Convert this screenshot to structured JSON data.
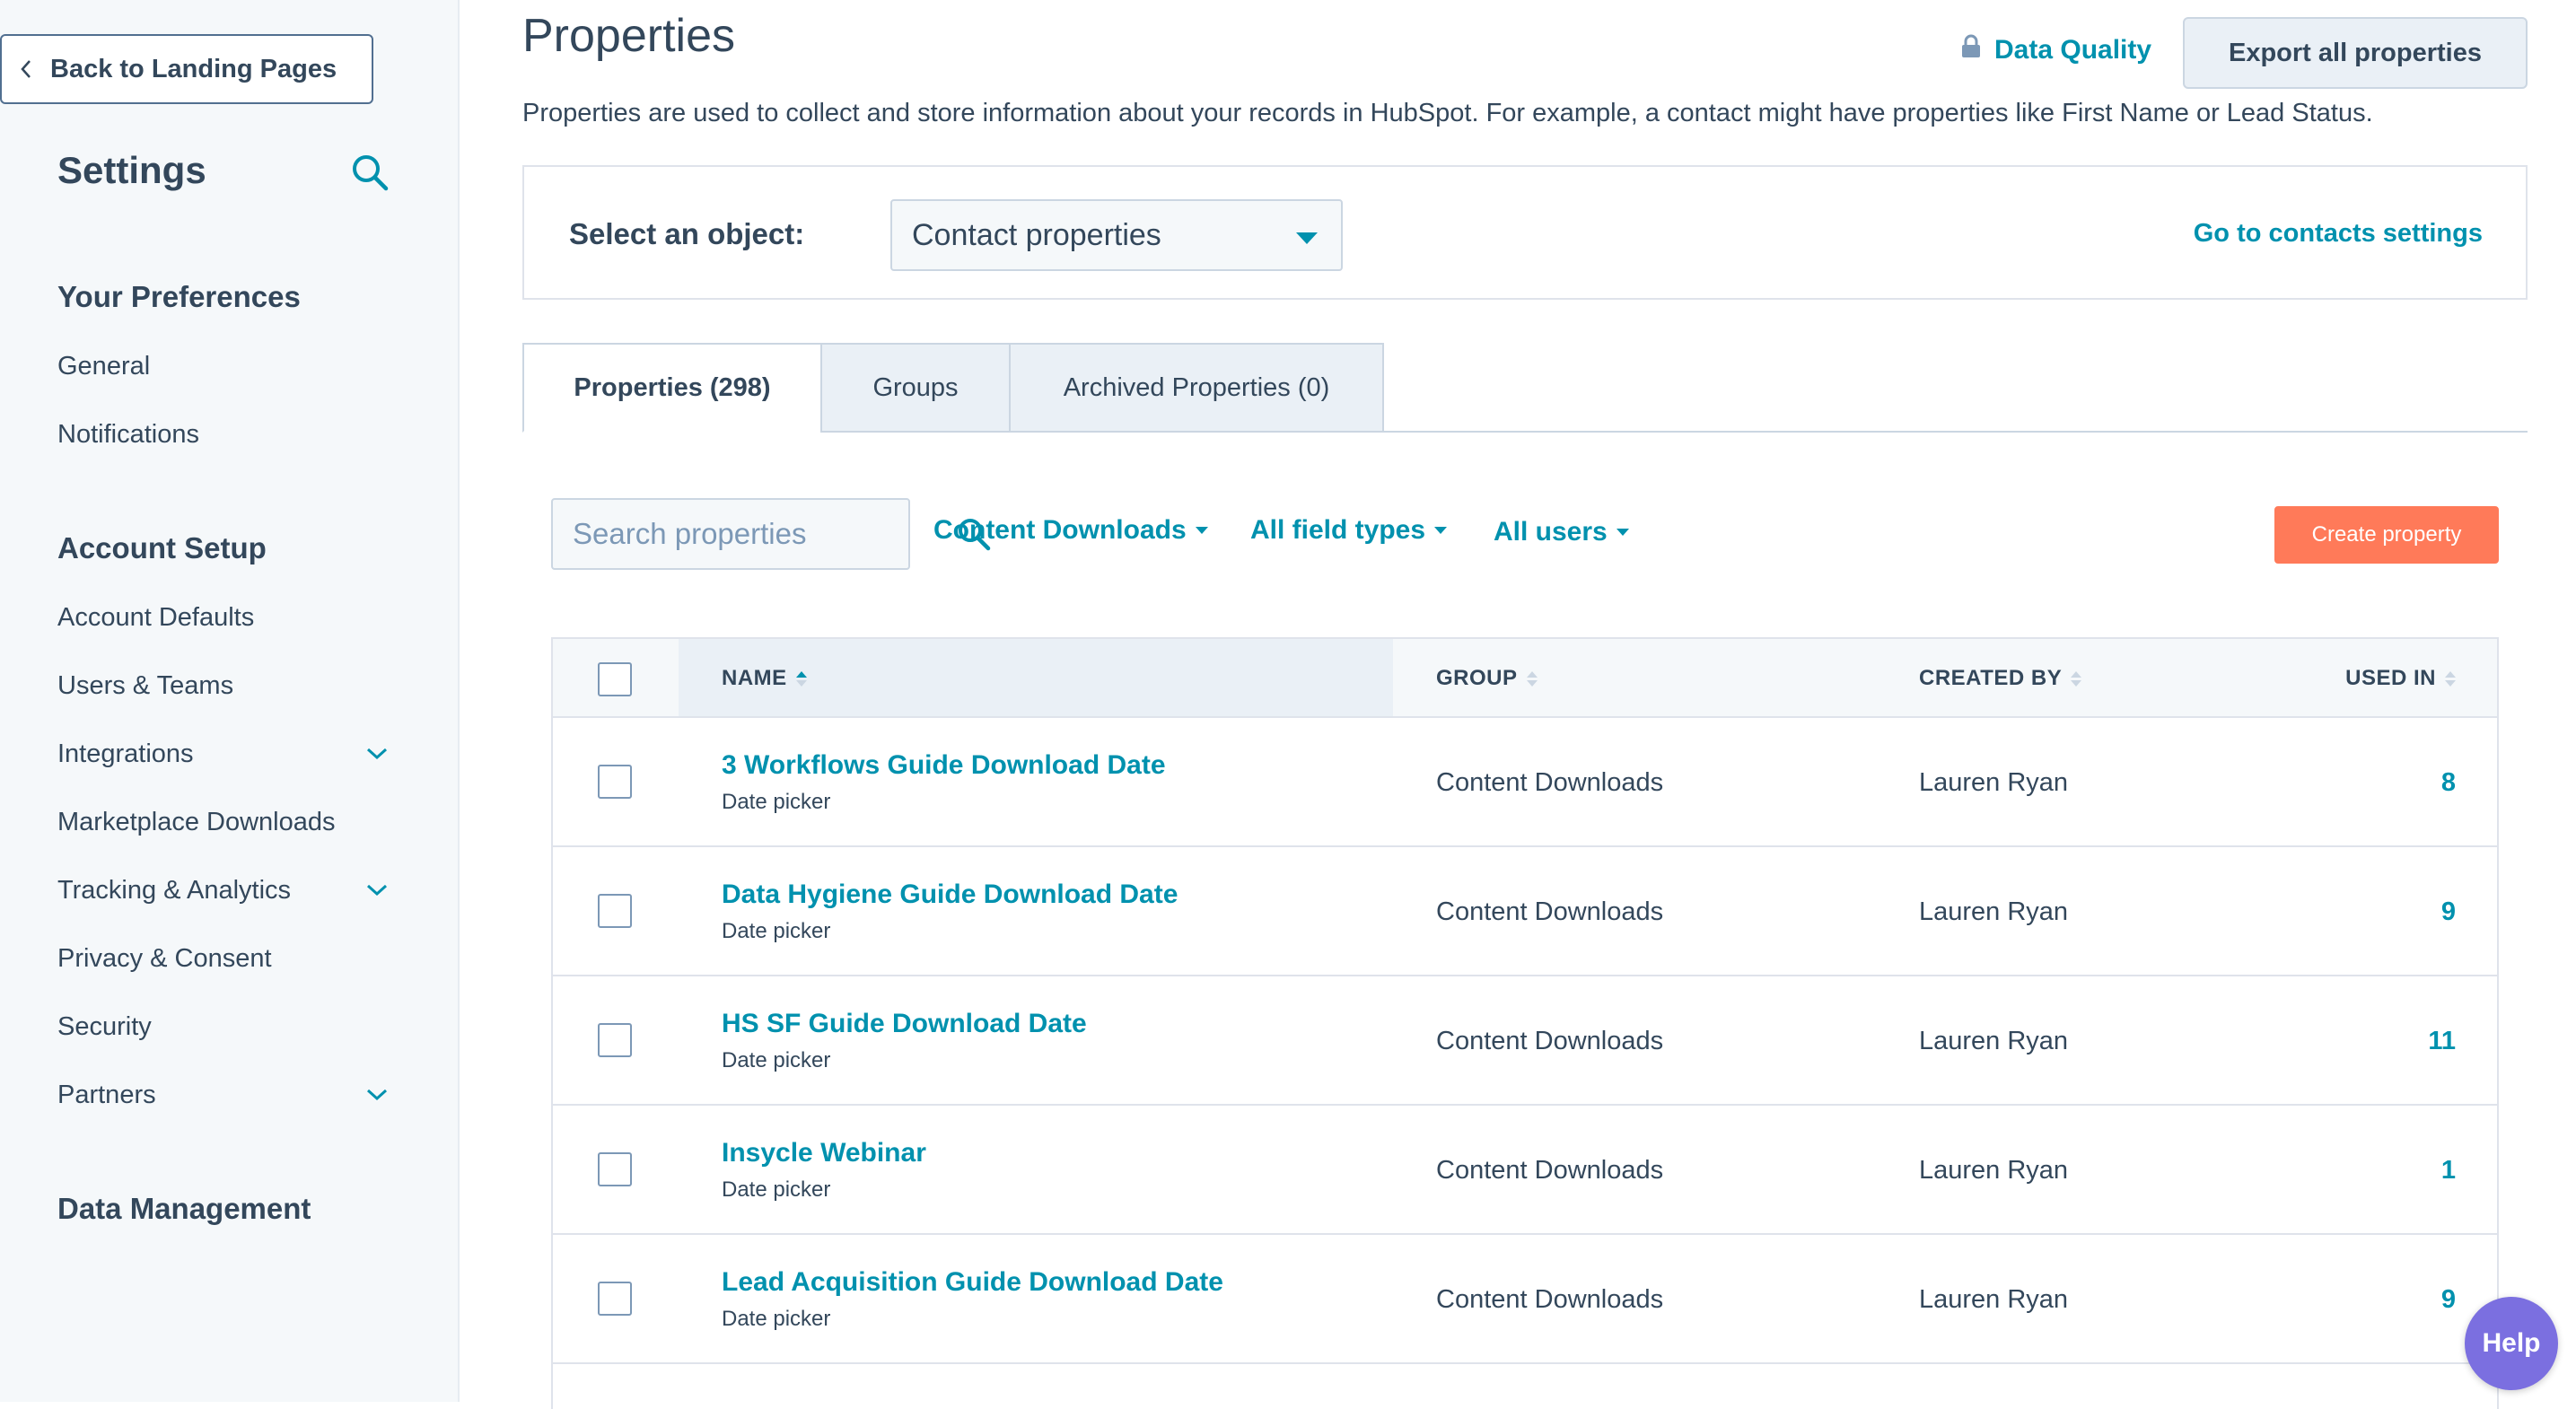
{
  "sidebar": {
    "back_label": "Back to Landing Pages",
    "title": "Settings",
    "sections": [
      {
        "title": "Your Preferences",
        "items": [
          {
            "label": "General",
            "expandable": false
          },
          {
            "label": "Notifications",
            "expandable": false
          }
        ]
      },
      {
        "title": "Account Setup",
        "items": [
          {
            "label": "Account Defaults",
            "expandable": false
          },
          {
            "label": "Users & Teams",
            "expandable": false
          },
          {
            "label": "Integrations",
            "expandable": true
          },
          {
            "label": "Marketplace Downloads",
            "expandable": false
          },
          {
            "label": "Tracking & Analytics",
            "expandable": true
          },
          {
            "label": "Privacy & Consent",
            "expandable": false
          },
          {
            "label": "Security",
            "expandable": false
          },
          {
            "label": "Partners",
            "expandable": true
          }
        ]
      },
      {
        "title": "Data Management",
        "items": []
      }
    ]
  },
  "header": {
    "title": "Properties",
    "data_quality_label": "Data Quality",
    "export_label": "Export all properties",
    "description": "Properties are used to collect and store information about your records in HubSpot. For example, a contact might have properties like First Name or Lead Status."
  },
  "object_select": {
    "label": "Select an object:",
    "value": "Contact properties",
    "settings_link": "Go to contacts settings"
  },
  "tabs": [
    {
      "label": "Properties (298)",
      "active": true
    },
    {
      "label": "Groups",
      "active": false
    },
    {
      "label": "Archived Properties (0)",
      "active": false
    }
  ],
  "filters": {
    "search_placeholder": "Search properties",
    "group_filter": "Content Downloads",
    "field_type_filter": "All field types",
    "users_filter": "All users",
    "create_label": "Create property"
  },
  "table": {
    "columns": {
      "name": "NAME",
      "group": "GROUP",
      "created_by": "CREATED BY",
      "used_in": "USED IN"
    },
    "rows": [
      {
        "name": "3 Workflows Guide Download Date",
        "type": "Date picker",
        "group": "Content Downloads",
        "created_by": "Lauren Ryan",
        "used_in": "8"
      },
      {
        "name": "Data Hygiene Guide Download Date",
        "type": "Date picker",
        "group": "Content Downloads",
        "created_by": "Lauren Ryan",
        "used_in": "9"
      },
      {
        "name": "HS SF Guide Download Date",
        "type": "Date picker",
        "group": "Content Downloads",
        "created_by": "Lauren Ryan",
        "used_in": "11"
      },
      {
        "name": "Insycle Webinar",
        "type": "Date picker",
        "group": "Content Downloads",
        "created_by": "Lauren Ryan",
        "used_in": "1"
      },
      {
        "name": "Lead Acquisition Guide Download Date",
        "type": "Date picker",
        "group": "Content Downloads",
        "created_by": "Lauren Ryan",
        "used_in": "9"
      }
    ]
  },
  "help_label": "Help",
  "colors": {
    "link": "#0091ae",
    "primary_action": "#ff7a59",
    "text": "#33475b",
    "help": "#7b6fe0"
  }
}
